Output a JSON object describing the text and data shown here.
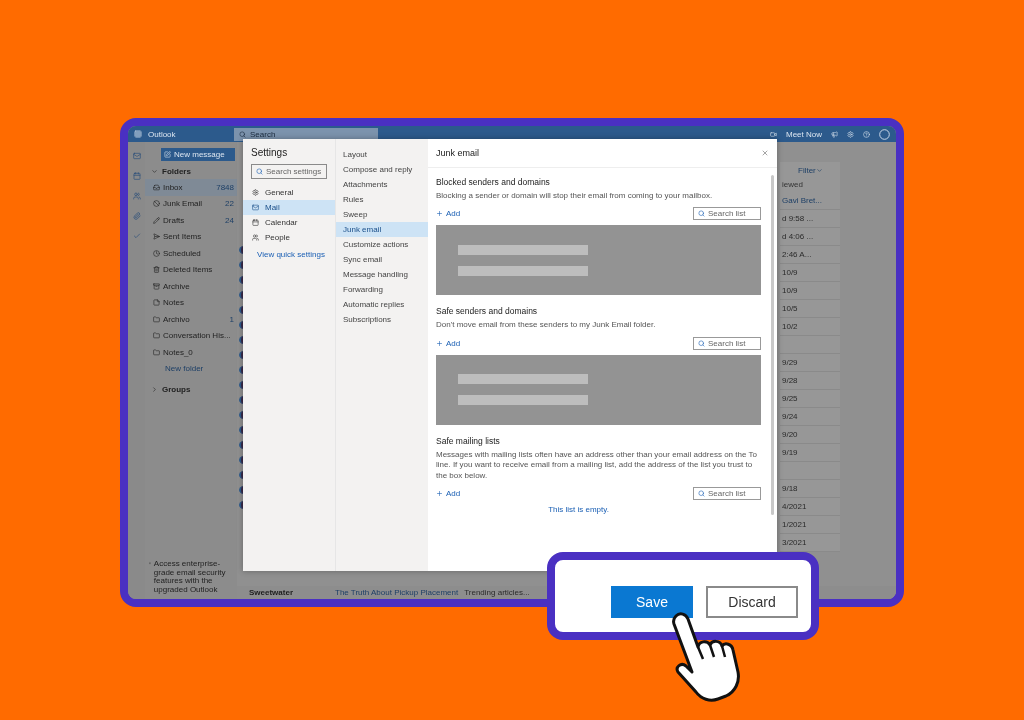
{
  "app_bar": {
    "app_name": "Outlook",
    "search_placeholder": "Search",
    "meet_now": "Meet Now"
  },
  "folder_pane": {
    "new_message": "New message",
    "folders_header": "Folders",
    "folders": [
      {
        "name": "Inbox",
        "count": "7848",
        "selected": true
      },
      {
        "name": "Junk Email",
        "count": "22",
        "selected": false
      },
      {
        "name": "Drafts",
        "count": "24",
        "selected": false
      },
      {
        "name": "Sent Items",
        "selected": false
      },
      {
        "name": "Scheduled",
        "selected": false
      },
      {
        "name": "Deleted Items",
        "selected": false
      },
      {
        "name": "Archive",
        "selected": false
      },
      {
        "name": "Notes",
        "selected": false
      },
      {
        "name": "Archivo",
        "count": "1",
        "selected": false
      },
      {
        "name": "Conversation His...",
        "selected": false
      },
      {
        "name": "Notes_0",
        "selected": false
      }
    ],
    "new_folder": "New folder",
    "groups": "Groups",
    "promo": "Access enterprise-grade email security features with the upgraded Outlook"
  },
  "message_list": {
    "filter": "Filter",
    "sort": "iewed",
    "rows": [
      "Gavi Bret...",
      "d 9:58 ...",
      "d 4:06 ...",
      "2:46 A...",
      "10/9",
      "10/9",
      "10/5",
      "10/2",
      "",
      "9/29",
      "9/28",
      "9/25",
      "9/24",
      "9/20",
      "9/19",
      "",
      "9/18",
      "4/2021",
      "1/2021",
      "3/2021"
    ],
    "bottom_row": {
      "sender": "Sweetwater",
      "subject": "The Truth About Pickup Placement",
      "preview": "Trending articles..."
    }
  },
  "settings": {
    "title": "Settings",
    "search_placeholder": "Search settings",
    "categories": [
      {
        "label": "General",
        "selected": false
      },
      {
        "label": "Mail",
        "selected": true
      },
      {
        "label": "Calendar",
        "selected": false
      },
      {
        "label": "People",
        "selected": false
      }
    ],
    "view_quick_settings": "View quick settings",
    "subcategories": [
      {
        "label": "Layout",
        "selected": false
      },
      {
        "label": "Compose and reply",
        "selected": false
      },
      {
        "label": "Attachments",
        "selected": false
      },
      {
        "label": "Rules",
        "selected": false
      },
      {
        "label": "Sweep",
        "selected": false
      },
      {
        "label": "Junk email",
        "selected": true
      },
      {
        "label": "Customize actions",
        "selected": false
      },
      {
        "label": "Sync email",
        "selected": false
      },
      {
        "label": "Message handling",
        "selected": false
      },
      {
        "label": "Forwarding",
        "selected": false
      },
      {
        "label": "Automatic replies",
        "selected": false
      },
      {
        "label": "Subscriptions",
        "selected": false
      }
    ],
    "panel": {
      "title": "Junk email",
      "sections": [
        {
          "kind": "redacted",
          "heading": "Blocked senders and domains",
          "description": "Blocking a sender or domain will stop their email from coming to your mailbox.",
          "add": "Add",
          "search_placeholder": "Search list"
        },
        {
          "kind": "redacted",
          "heading": "Safe senders and domains",
          "description": "Don't move email from these senders to my Junk Email folder.",
          "add": "Add",
          "search_placeholder": "Search list"
        },
        {
          "kind": "empty",
          "heading": "Safe mailing lists",
          "description": "Messages with mailing lists often have an address other than your email address on the To line. If you want to receive email from a mailing list, add the address of the list you trust to the box below.",
          "add": "Add",
          "search_placeholder": "Search list",
          "empty_text": "This list is empty."
        }
      ]
    }
  },
  "footer": {
    "buttons": [
      {
        "label": "Save",
        "kind": "primary"
      },
      {
        "label": "Discard",
        "kind": "secondary"
      }
    ]
  }
}
